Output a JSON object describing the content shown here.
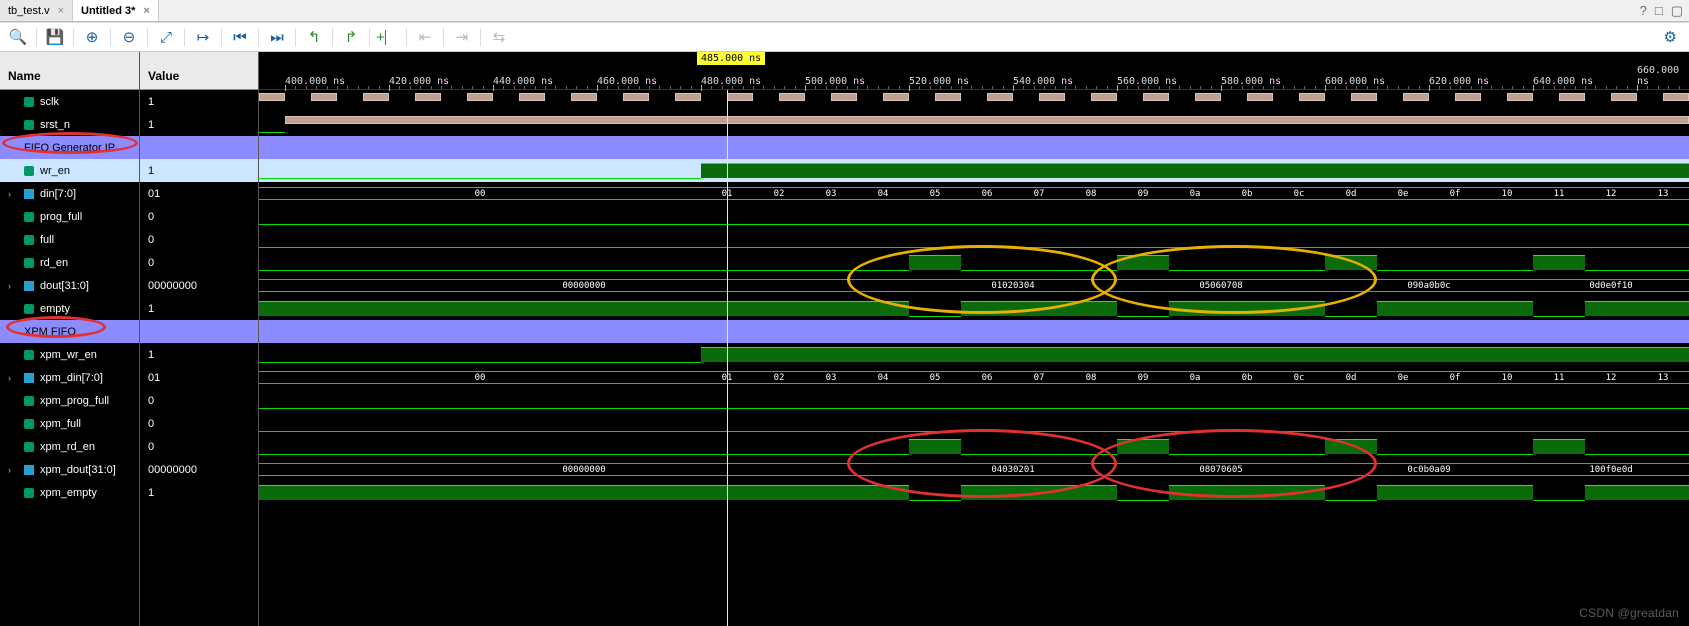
{
  "tabs": [
    {
      "label": "tb_test.v",
      "active": false
    },
    {
      "label": "Untitled 3*",
      "active": true
    }
  ],
  "cols": {
    "name": "Name",
    "value": "Value"
  },
  "cursor": {
    "label": "485.000 ns",
    "time": 485
  },
  "time_range": {
    "start": 395,
    "end": 670
  },
  "ticks": [
    400,
    420,
    440,
    460,
    480,
    500,
    520,
    540,
    560,
    580,
    600,
    620,
    640,
    660
  ],
  "signals": [
    {
      "name": "sclk",
      "value": "1",
      "type": "wire"
    },
    {
      "name": "srst_n",
      "value": "1",
      "type": "wire"
    },
    {
      "name": "FIFO Generator IP",
      "value": "",
      "type": "group",
      "hl": "group",
      "circle": true
    },
    {
      "name": "wr_en",
      "value": "1",
      "type": "wire",
      "hl": "sel"
    },
    {
      "name": "din[7:0]",
      "value": "01",
      "type": "bus",
      "expand": true
    },
    {
      "name": "prog_full",
      "value": "0",
      "type": "wire"
    },
    {
      "name": "full",
      "value": "0",
      "type": "wire"
    },
    {
      "name": "rd_en",
      "value": "0",
      "type": "wire"
    },
    {
      "name": "dout[31:0]",
      "value": "00000000",
      "type": "bus",
      "expand": true
    },
    {
      "name": "empty",
      "value": "1",
      "type": "wire"
    },
    {
      "name": "XPM FIFO",
      "value": "",
      "type": "group",
      "hl": "group",
      "circle": true
    },
    {
      "name": "xpm_wr_en",
      "value": "1",
      "type": "wire"
    },
    {
      "name": "xpm_din[7:0]",
      "value": "01",
      "type": "bus",
      "expand": true
    },
    {
      "name": "xpm_prog_full",
      "value": "0",
      "type": "wire"
    },
    {
      "name": "xpm_full",
      "value": "0",
      "type": "wire"
    },
    {
      "name": "xpm_rd_en",
      "value": "0",
      "type": "wire"
    },
    {
      "name": "xpm_dout[31:0]",
      "value": "00000000",
      "type": "bus",
      "expand": true
    },
    {
      "name": "xpm_empty",
      "value": "1",
      "type": "wire"
    }
  ],
  "din_segs": [
    "00",
    "01",
    "02",
    "03",
    "04",
    "05",
    "06",
    "07",
    "08",
    "09",
    "0a",
    "0b",
    "0c",
    "0d",
    "0e",
    "0f",
    "10",
    "11",
    "12",
    "13"
  ],
  "dout_segs": [
    {
      "t0": 395,
      "t1": 520,
      "v": "00000000"
    },
    {
      "t0": 520,
      "t1": 560,
      "v": "01020304"
    },
    {
      "t0": 560,
      "t1": 600,
      "v": "05060708"
    },
    {
      "t0": 600,
      "t1": 640,
      "v": "090a0b0c"
    },
    {
      "t0": 640,
      "t1": 670,
      "v": "0d0e0f10"
    }
  ],
  "xpm_dout_segs": [
    {
      "t0": 395,
      "t1": 520,
      "v": "00000000"
    },
    {
      "t0": 520,
      "t1": 560,
      "v": "04030201"
    },
    {
      "t0": 560,
      "t1": 600,
      "v": "08070605"
    },
    {
      "t0": 600,
      "t1": 640,
      "v": "0c0b0a09"
    },
    {
      "t0": 640,
      "t1": 670,
      "v": "100f0e0d"
    }
  ],
  "rd_en_pulses": [
    [
      520,
      530
    ],
    [
      560,
      570
    ],
    [
      600,
      610
    ],
    [
      640,
      650
    ]
  ],
  "empty_fill": [
    [
      395,
      520
    ],
    [
      530,
      560
    ],
    [
      570,
      600
    ],
    [
      610,
      640
    ],
    [
      650,
      670
    ]
  ],
  "annotations": [
    {
      "cls": "y",
      "row": 7,
      "t0": 508,
      "t1": 560,
      "rowspan": 3
    },
    {
      "cls": "y",
      "row": 7,
      "t0": 555,
      "t1": 610,
      "rowspan": 3
    },
    {
      "cls": "r",
      "row": 15,
      "t0": 508,
      "t1": 560,
      "rowspan": 3
    },
    {
      "cls": "r",
      "row": 15,
      "t0": 555,
      "t1": 610,
      "rowspan": 3
    }
  ],
  "watermark": "CSDN @greatdan"
}
